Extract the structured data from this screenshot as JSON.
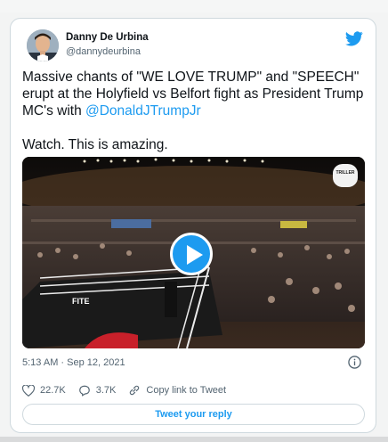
{
  "tweet": {
    "author_name": "Danny De Urbina",
    "author_handle": "@dannydeurbina",
    "text_line_1": "Massive chants of \"WE LOVE TRUMP\" and \"SPEECH\" erupt at the Holyfield vs Belfort fight as President Trump MC's with ",
    "mention": "@DonaldJTrumpJr",
    "text_line_2": "Watch. This is amazing.",
    "timestamp": "5:13 AM · Sep 12, 2021",
    "like_count": "22.7K",
    "reply_count": "3.7K",
    "copy_link_label": "Copy link to Tweet",
    "reply_button_label": "Tweet your reply"
  },
  "media": {
    "type": "video",
    "logo_text": "TRILLER",
    "ring_text": "FITE"
  },
  "colors": {
    "accent": "#1d9bf0",
    "secondary_text": "#536471",
    "border": "#cfd9de"
  },
  "icons": [
    "twitter-bird-icon",
    "play-icon",
    "info-icon",
    "heart-icon",
    "reply-icon",
    "link-icon"
  ]
}
